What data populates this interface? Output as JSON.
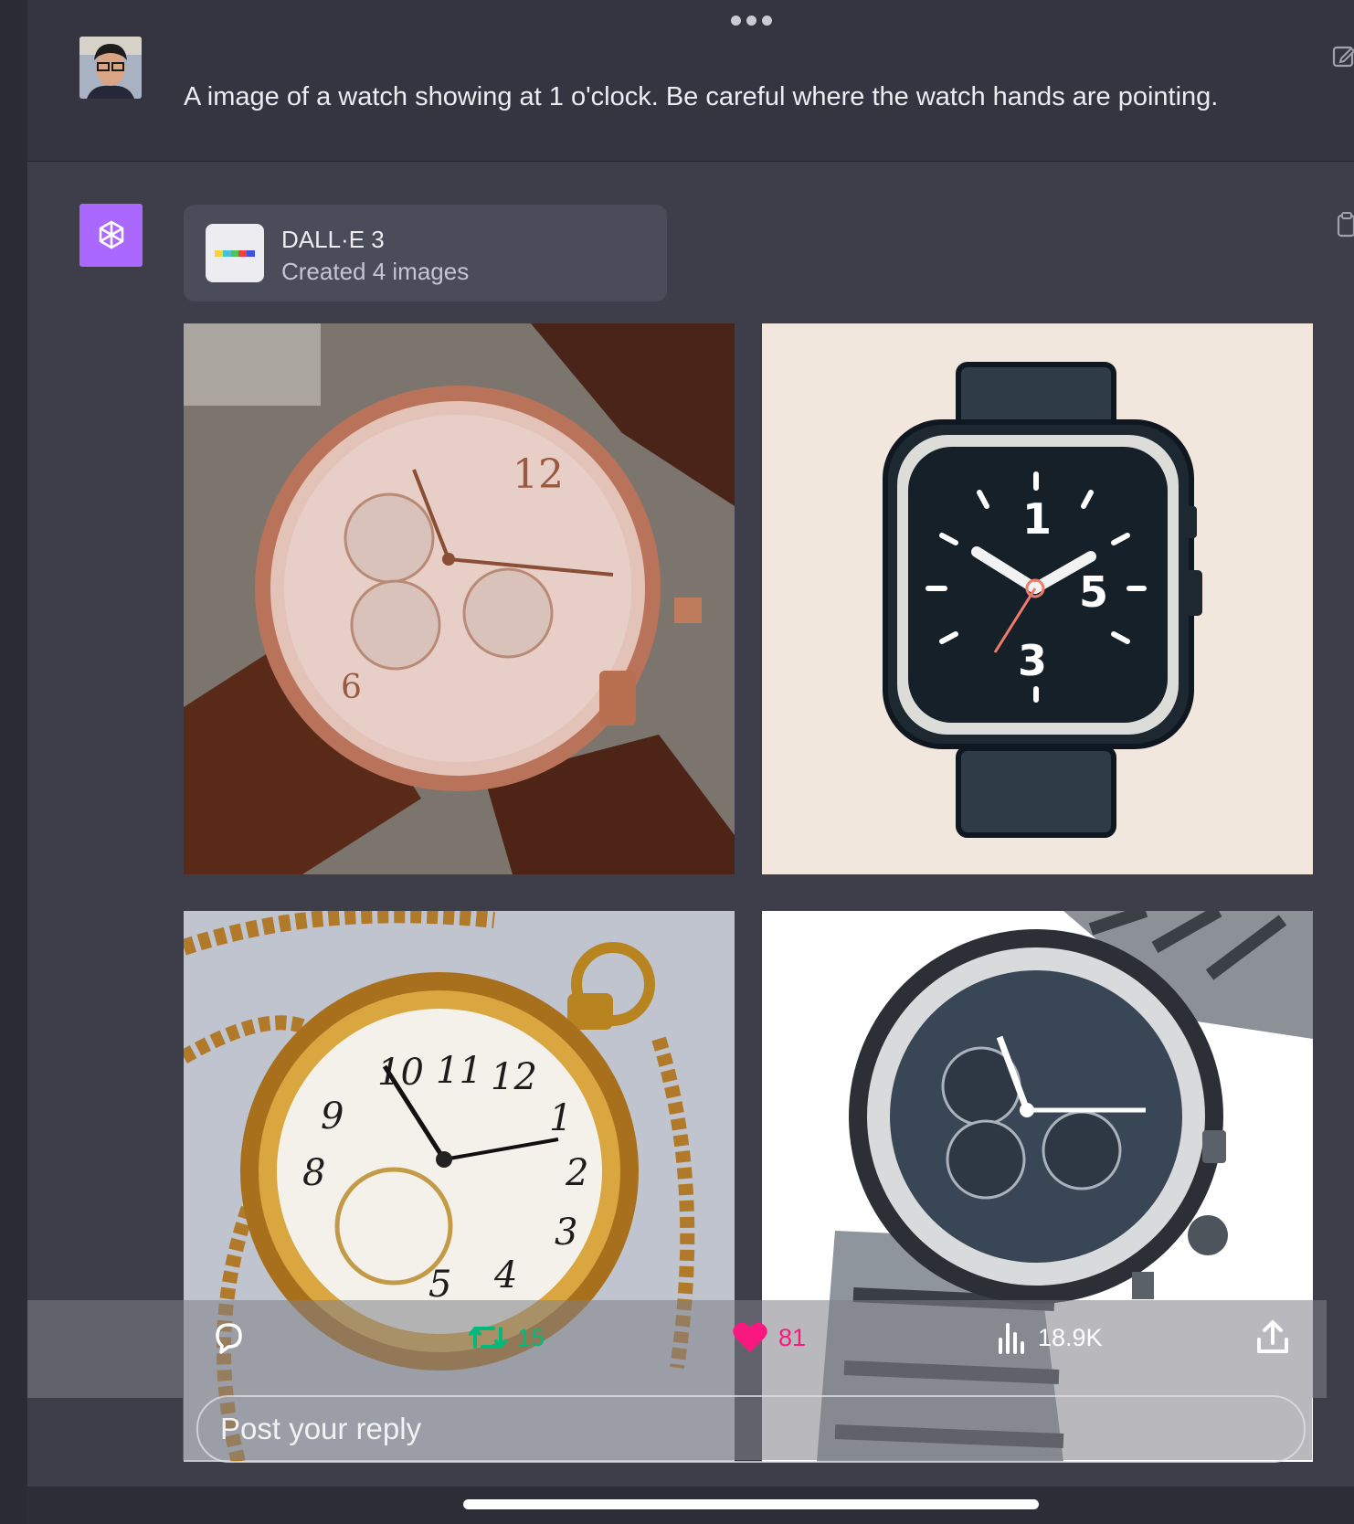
{
  "user_message": {
    "text": "A image of a watch showing at 1 o'clock. Be careful where the watch hands are pointing."
  },
  "dalle_card": {
    "title": "DALL·E 3",
    "subtitle": "Created 4 images"
  },
  "images": [
    {
      "description": "rose-gold chronograph on brown leather strap",
      "dial_numerals": [
        "12",
        "6"
      ]
    },
    {
      "description": "flat illustration of a square smartwatch",
      "dial_numerals": [
        "1",
        "5",
        "3"
      ]
    },
    {
      "description": "gold pocket watch with chain",
      "dial_numerals": [
        "11",
        "12",
        "1",
        "2",
        "3",
        "4",
        "5",
        "8",
        "9",
        "10"
      ]
    },
    {
      "description": "steel dive chronograph, watercolor style",
      "dial_numerals": []
    }
  ],
  "actions": {
    "retweets": "15",
    "likes": "81",
    "views": "18.9K"
  },
  "reply": {
    "placeholder": "Post your reply"
  },
  "colors": {
    "retweet": "#00ba7c",
    "like": "#f91880",
    "assistant_avatar": "#ab68ff",
    "page_bg": "#343541"
  },
  "icons": [
    "more-dots-icon",
    "edit-icon",
    "openai-logo-icon",
    "copy-icon",
    "reply-icon",
    "retweet-icon",
    "heart-icon",
    "views-icon",
    "share-icon"
  ]
}
